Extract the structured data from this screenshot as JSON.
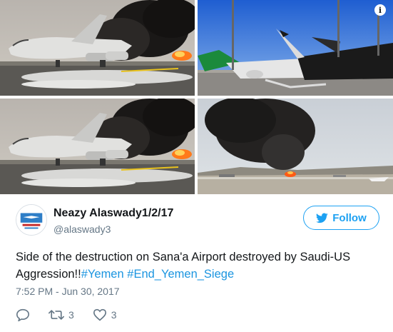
{
  "media": {
    "photos": [
      {
        "alt": "cargo-plane-burning"
      },
      {
        "alt": "airliner-burned"
      },
      {
        "alt": "cargo-plane-burning-duplicate"
      },
      {
        "alt": "smoke-over-airport"
      }
    ],
    "info_label": "i"
  },
  "author": {
    "name": "Neazy Alaswady1/2/17",
    "handle": "@alaswady3"
  },
  "follow_button": {
    "label": "Follow"
  },
  "tweet": {
    "text": "Side of the destruction on Sana'a Airport destroyed by Saudi-US Aggression!!",
    "hashtag_1": "#Yemen",
    "separator": " ",
    "hashtag_2": "#End_Yemen_Siege"
  },
  "timestamp": "7:52 PM - Jun 30, 2017",
  "actions": {
    "reply_icon": "reply-icon",
    "retweet_icon": "retweet-icon",
    "retweet_count": "3",
    "like_icon": "heart-icon",
    "like_count": "3"
  },
  "colors": {
    "brand_blue": "#1da1f2",
    "hashtag_blue": "#1b95e0",
    "muted_gray": "#657786",
    "text_dark": "#14171a"
  }
}
